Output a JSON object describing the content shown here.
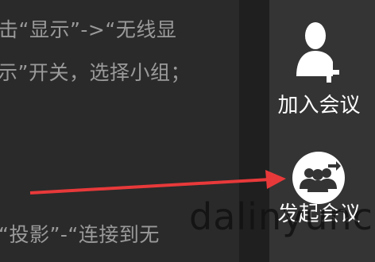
{
  "instructions": {
    "line1": "击“显示”->“无线显",
    "line2": "示”开关，选择小组；",
    "line3": ")",
    "line4": "“投影”-“连接到无"
  },
  "sidebar": {
    "join_meeting_label": "加入会议",
    "start_meeting_label": "发起会议"
  },
  "watermark": "dalinyunci",
  "colors": {
    "annotation_arrow": "#e8393a",
    "sidebar_bg": "#343434",
    "icon_white": "#ffffff"
  },
  "icons": {
    "join": "add-user-icon",
    "start": "group-meeting-icon"
  }
}
